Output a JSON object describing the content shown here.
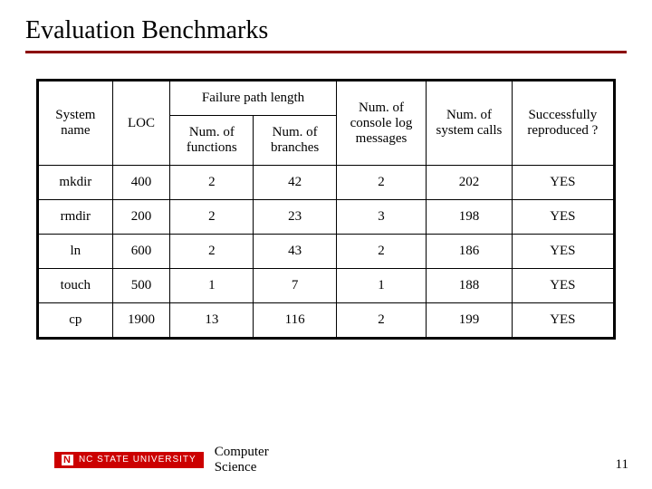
{
  "title": "Evaluation Benchmarks",
  "headers": {
    "system_name": "System name",
    "loc": "LOC",
    "failure_path_length": "Failure path length",
    "num_functions": "Num. of functions",
    "num_branches": "Num. of branches",
    "num_console": "Num. of console log messages",
    "num_syscalls": "Num. of system calls",
    "reproduced": "Successfully reproduced ?"
  },
  "rows": [
    {
      "name": "mkdir",
      "loc": "400",
      "nfunc": "2",
      "nbranch": "42",
      "nconsole": "2",
      "nsyscall": "202",
      "repro": "YES"
    },
    {
      "name": "rmdir",
      "loc": "200",
      "nfunc": "2",
      "nbranch": "23",
      "nconsole": "3",
      "nsyscall": "198",
      "repro": "YES"
    },
    {
      "name": "ln",
      "loc": "600",
      "nfunc": "2",
      "nbranch": "43",
      "nconsole": "2",
      "nsyscall": "186",
      "repro": "YES"
    },
    {
      "name": "touch",
      "loc": "500",
      "nfunc": "1",
      "nbranch": "7",
      "nconsole": "1",
      "nsyscall": "188",
      "repro": "YES"
    },
    {
      "name": "cp",
      "loc": "1900",
      "nfunc": "13",
      "nbranch": "116",
      "nconsole": "2",
      "nsyscall": "199",
      "repro": "YES"
    }
  ],
  "footer": {
    "logo_nc": "N",
    "logo_text": "NC STATE UNIVERSITY",
    "dept_line1": "Computer",
    "dept_line2": "Science"
  },
  "page_number": "11",
  "chart_data": {
    "type": "table",
    "title": "Evaluation Benchmarks",
    "columns": [
      "System name",
      "LOC",
      "Num. of functions",
      "Num. of branches",
      "Num. of console log messages",
      "Num. of system calls",
      "Successfully reproduced ?"
    ],
    "rows": [
      [
        "mkdir",
        400,
        2,
        42,
        2,
        202,
        "YES"
      ],
      [
        "rmdir",
        200,
        2,
        23,
        3,
        198,
        "YES"
      ],
      [
        "ln",
        600,
        2,
        43,
        2,
        186,
        "YES"
      ],
      [
        "touch",
        500,
        1,
        7,
        1,
        188,
        "YES"
      ],
      [
        "cp",
        1900,
        13,
        116,
        2,
        199,
        "YES"
      ]
    ]
  }
}
